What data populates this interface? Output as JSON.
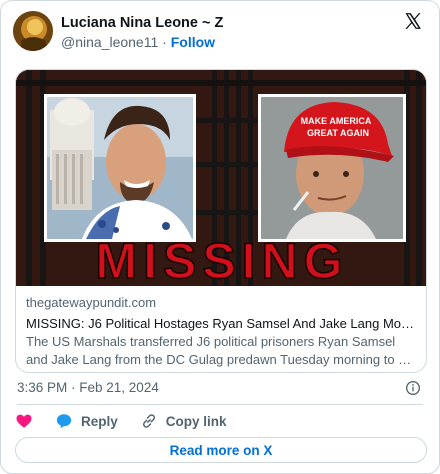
{
  "author": {
    "display_name": "Luciana Nina Leone ~ Z",
    "handle": "@nina_leone11",
    "separator": "·",
    "follow_label": "Follow"
  },
  "card": {
    "image_caption": "MISSING",
    "image_cap_text": "MAKE AMERICA GREAT AGAIN",
    "domain": "thegatewaypundit.com",
    "title": "MISSING: J6 Political Hostages Ryan Samsel And Jake Lang Moved…",
    "description": "The US Marshals transferred J6 political prisoners Ryan Samsel and Jake Lang from the DC Gulag predawn Tuesday morning to an …"
  },
  "meta": {
    "timestamp": "3:36 PM · Feb 21, 2024"
  },
  "actions": {
    "like_icon": "heart-icon",
    "reply_label": "Reply",
    "copy_link_label": "Copy link"
  },
  "read_more_label": "Read more on X",
  "colors": {
    "accent": "#006fd6",
    "like": "#f91880",
    "reply": "#1d9bf0",
    "caption_red": "#d0101a",
    "muted": "#536471",
    "border": "#cfd9de"
  }
}
